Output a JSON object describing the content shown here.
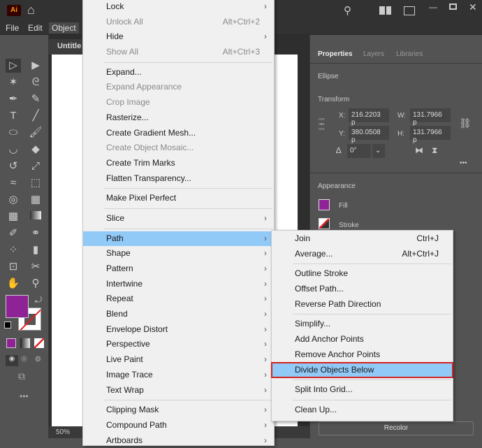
{
  "app": {
    "logo": "Ai",
    "menus": [
      "File",
      "Edit",
      "Object"
    ],
    "doc_tab": "Untitle",
    "zoom": "50%"
  },
  "panel": {
    "tabs": [
      "Properties",
      "Layers",
      "Libraries"
    ],
    "object_type": "Ellipse",
    "transform_title": "Transform",
    "x_label": "X:",
    "x": "216.2203 p",
    "y_label": "Y:",
    "y": "380.0508 p",
    "w_label": "W:",
    "w": "131.7966 p",
    "h_label": "H:",
    "h": "131.7966 p",
    "angle": "0°",
    "appearance_title": "Appearance",
    "fill": "Fill",
    "stroke": "Stroke",
    "recolor": "Recolor",
    "fill_color": "#8e2396"
  },
  "menu": {
    "items": [
      {
        "label": "Lock",
        "arrow": true
      },
      {
        "label": "Unlock All",
        "shortcut": "Alt+Ctrl+2",
        "disabled": true
      },
      {
        "label": "Hide",
        "arrow": true
      },
      {
        "label": "Show All",
        "shortcut": "Alt+Ctrl+3",
        "disabled": true
      },
      {
        "sep": true
      },
      {
        "label": "Expand..."
      },
      {
        "label": "Expand Appearance",
        "disabled": true
      },
      {
        "label": "Crop Image",
        "disabled": true
      },
      {
        "label": "Rasterize..."
      },
      {
        "label": "Create Gradient Mesh..."
      },
      {
        "label": "Create Object Mosaic...",
        "disabled": true
      },
      {
        "label": "Create Trim Marks"
      },
      {
        "label": "Flatten Transparency..."
      },
      {
        "sep": true
      },
      {
        "label": "Make Pixel Perfect"
      },
      {
        "sep": true
      },
      {
        "label": "Slice",
        "arrow": true
      },
      {
        "sep": true
      },
      {
        "label": "Path",
        "arrow": true,
        "highlighted": true
      },
      {
        "label": "Shape",
        "arrow": true
      },
      {
        "label": "Pattern",
        "arrow": true
      },
      {
        "label": "Intertwine",
        "arrow": true
      },
      {
        "label": "Repeat",
        "arrow": true
      },
      {
        "label": "Blend",
        "arrow": true
      },
      {
        "label": "Envelope Distort",
        "arrow": true
      },
      {
        "label": "Perspective",
        "arrow": true
      },
      {
        "label": "Live Paint",
        "arrow": true
      },
      {
        "label": "Image Trace",
        "arrow": true
      },
      {
        "label": "Text Wrap",
        "arrow": true
      },
      {
        "sep": true
      },
      {
        "label": "Clipping Mask",
        "arrow": true
      },
      {
        "label": "Compound Path",
        "arrow": true
      },
      {
        "label": "Artboards",
        "arrow": true
      }
    ]
  },
  "submenu": {
    "items": [
      {
        "label": "Join",
        "shortcut": "Ctrl+J"
      },
      {
        "label": "Average...",
        "shortcut": "Alt+Ctrl+J"
      },
      {
        "sep": true
      },
      {
        "label": "Outline Stroke"
      },
      {
        "label": "Offset Path..."
      },
      {
        "label": "Reverse Path Direction"
      },
      {
        "sep": true
      },
      {
        "label": "Simplify..."
      },
      {
        "label": "Add Anchor Points"
      },
      {
        "label": "Remove Anchor Points"
      },
      {
        "label": "Divide Objects Below",
        "highlighted": true
      },
      {
        "sep": true
      },
      {
        "label": "Split Into Grid..."
      },
      {
        "sep": true
      },
      {
        "label": "Clean Up..."
      }
    ]
  },
  "arrow_glyph": "›"
}
